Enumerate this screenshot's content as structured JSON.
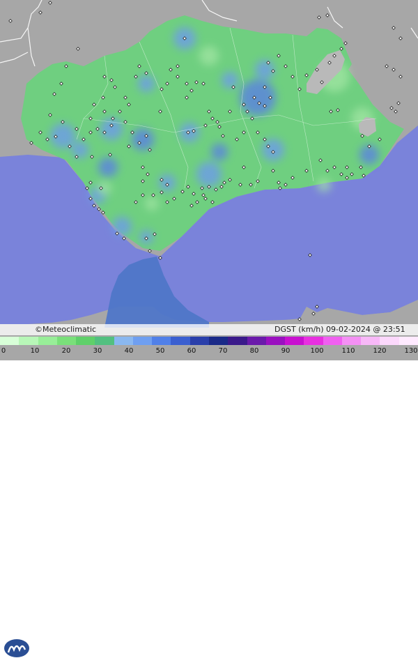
{
  "map": {
    "colors": {
      "land_outside": "#a7a7a7",
      "sea": "#7a83da",
      "andalusia_base": "#6fcf80",
      "strait_water": "#4f76c8",
      "mountain": "#b9b9b9",
      "border": "#ffffff",
      "station_dot": "#ffffff"
    }
  },
  "info": {
    "brand": "Meteoclimatic",
    "copyright_symbol": "©",
    "parameter": "DGST (km/h)",
    "datetime": "09-02-2024 @ 23:51 UTC"
  },
  "scale": {
    "ticks": [
      "0",
      "10",
      "20",
      "30",
      "40",
      "50",
      "60",
      "70",
      "80",
      "90",
      "100",
      "110",
      "120",
      "130"
    ],
    "colors": [
      "#d8ffd8",
      "#b8f7b8",
      "#98ee98",
      "#7ae07a",
      "#5fd06a",
      "#52c080",
      "#8ab8f0",
      "#6f9ff0",
      "#5080e8",
      "#3a5fd0",
      "#2a3faa",
      "#1a2a88",
      "#3a1a8a",
      "#6a1aaa",
      "#9a10c0",
      "#c810d0",
      "#e830e0",
      "#f060f0",
      "#f490f4",
      "#f8b8f8",
      "#fcd8fc",
      "#ffeaff"
    ]
  }
}
